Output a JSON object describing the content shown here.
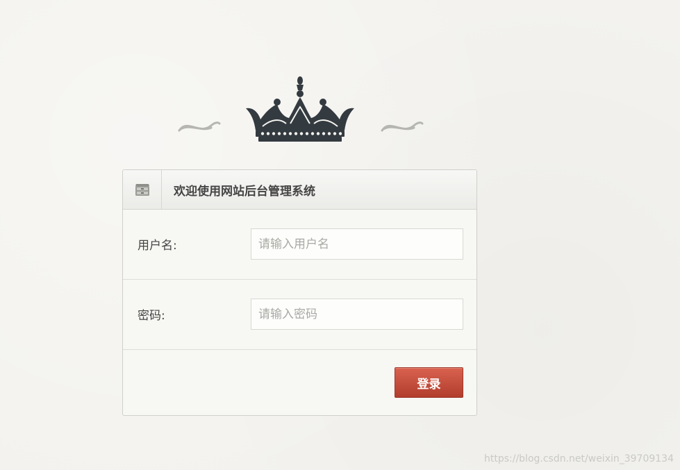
{
  "header": {
    "title": "欢迎使用网站后台管理系统"
  },
  "form": {
    "username": {
      "label": "用户名:",
      "placeholder": "请输入用户名",
      "value": ""
    },
    "password": {
      "label": "密码:",
      "placeholder": "请输入密码",
      "value": ""
    },
    "submit_label": "登录"
  },
  "icons": {
    "crest": "crown-icon",
    "header": "cabinet-icon"
  },
  "colors": {
    "accent": "#c24a38",
    "crown": "#333a40",
    "background": "#f3f2ee"
  },
  "watermark": "https://blog.csdn.net/weixin_39709134"
}
